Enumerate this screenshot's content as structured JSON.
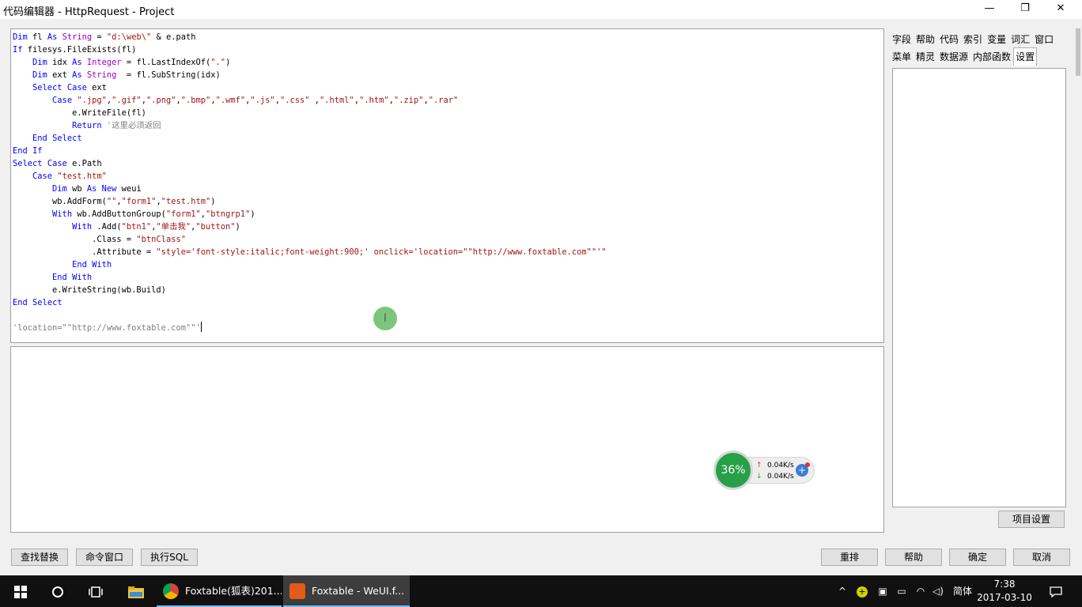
{
  "window": {
    "title": "代码编辑器 - HttpRequest - Project",
    "minimize_icon": "—",
    "restore_icon": "❐",
    "close_icon": "✕"
  },
  "editor": {
    "lines": [
      "Dim fl As String = \"d:\\web\\\" & e.path",
      "If filesys.FileExists(fl)",
      "    Dim idx As Integer = fl.LastIndexOf(\".\")",
      "    Dim ext As String  = fl.SubString(idx)",
      "    Select Case ext",
      "        Case \".jpg\",\".gif\",\".png\",\".bmp\",\".wmf\",\".js\",\".css\" ,\".html\",\".htm\",\".zip\",\".rar\"",
      "            e.WriteFile(fl)",
      "            Return '这里必须返回",
      "    End Select",
      "End If",
      "Select Case e.Path",
      "    Case \"test.htm\"",
      "        Dim wb As New weui",
      "        wb.AddForm(\"\",\"form1\",\"test.htm\")",
      "        With wb.AddButtonGroup(\"form1\",\"btngrp1\")",
      "            With .Add(\"btn1\",\"单击我\",\"button\")",
      "                .Class = \"btnClass\"",
      "                .Attribute = \"style='font-style:italic;font-weight:900;' onclick='location=\"\"http://www.foxtable.com\"\"'\"",
      "            End With",
      "        End With",
      "        e.WriteString(wb.Build)",
      "End Select",
      "",
      "'location=\"\"http://www.foxtable.com\"\"'"
    ]
  },
  "side_panel": {
    "tabs_row1": [
      "字段",
      "帮助",
      "代码",
      "索引",
      "变量",
      "词汇",
      "窗口"
    ],
    "tabs_row2": [
      "菜单",
      "精灵",
      "数据源",
      "内部函数",
      "设置"
    ],
    "active_tab": "设置",
    "project_settings_button": "项目设置"
  },
  "bottom_buttons": {
    "find_replace": "查找替换",
    "command_window": "命令窗口",
    "execute_sql": "执行SQL",
    "rearrange": "重排",
    "help": "帮助",
    "ok": "确定",
    "cancel": "取消"
  },
  "net_widget": {
    "percent": "36%",
    "upload": "0.04K/s",
    "download": "0.04K/s"
  },
  "taskbar": {
    "apps": [
      {
        "label": "Foxtable(狐表)201...",
        "active": false
      },
      {
        "label": "Foxtable - WeUI.f...",
        "active": true
      }
    ],
    "ime": "简体",
    "time": "7:38",
    "date": "2017-03-10"
  }
}
